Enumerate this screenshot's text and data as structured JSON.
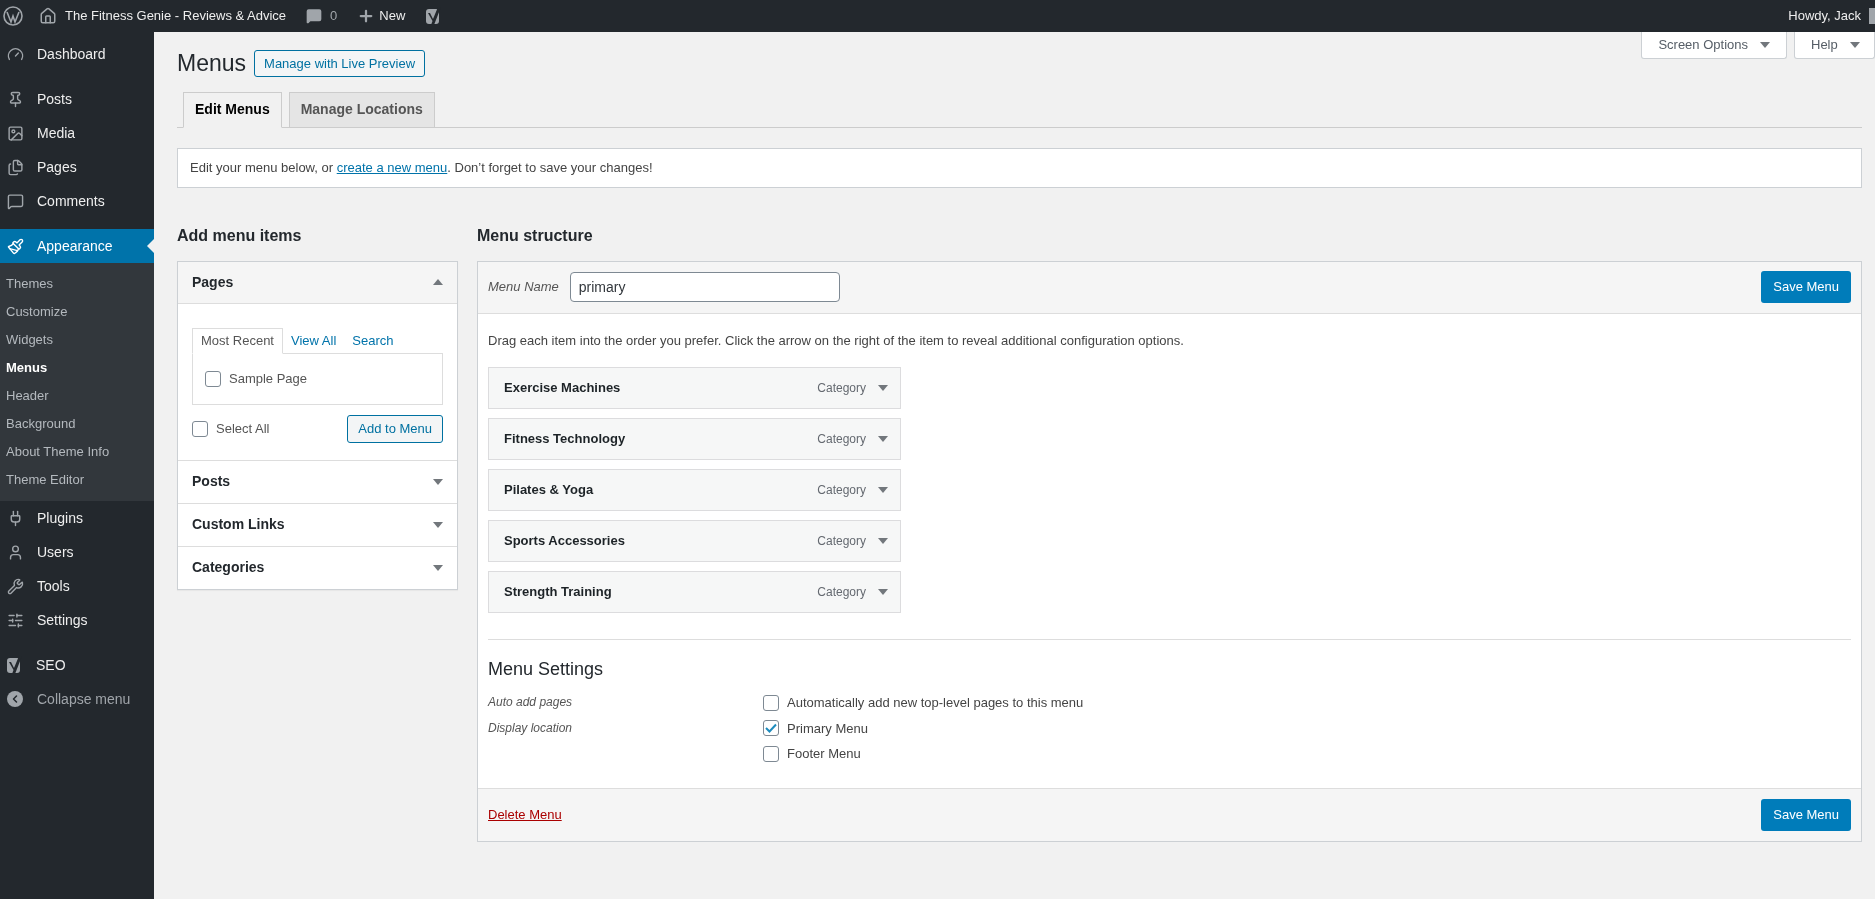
{
  "admin_bar": {
    "site_title": "The Fitness Genie - Reviews & Advice",
    "comments_count": "0",
    "new_label": "New",
    "greeting": "Howdy, Jack"
  },
  "sidebar": {
    "items": [
      {
        "label": "Dashboard",
        "selected": false,
        "gap_after": true
      },
      {
        "label": "Posts",
        "selected": false
      },
      {
        "label": "Media",
        "selected": false
      },
      {
        "label": "Pages",
        "selected": false
      },
      {
        "label": "Comments",
        "selected": false,
        "gap_after": true
      },
      {
        "label": "Appearance",
        "selected": true,
        "children": [
          {
            "label": "Themes",
            "selected": false
          },
          {
            "label": "Customize",
            "selected": false
          },
          {
            "label": "Widgets",
            "selected": false
          },
          {
            "label": "Menus",
            "selected": true
          },
          {
            "label": "Header",
            "selected": false
          },
          {
            "label": "Background",
            "selected": false
          },
          {
            "label": "About Theme Info",
            "selected": false
          },
          {
            "label": "Theme Editor",
            "selected": false
          }
        ]
      },
      {
        "label": "Plugins",
        "selected": false
      },
      {
        "label": "Users",
        "selected": false
      },
      {
        "label": "Tools",
        "selected": false
      },
      {
        "label": "Settings",
        "selected": false,
        "gap_after": true
      },
      {
        "label": "SEO",
        "selected": false
      },
      {
        "label": "Collapse menu",
        "selected": false,
        "kind": "collapse"
      }
    ]
  },
  "screen_meta": [
    "Screen Options",
    "Help"
  ],
  "page": {
    "title": "Menus",
    "action": "Manage with Live Preview",
    "tabs": [
      {
        "label": "Edit Menus",
        "selected": true
      },
      {
        "label": "Manage Locations",
        "selected": false
      }
    ],
    "notice": {
      "before": "Edit your menu below, or ",
      "link": "create a new menu",
      "after": ". Don’t forget to save your changes!"
    }
  },
  "add_menu_items": {
    "heading": "Add menu items",
    "sections": [
      {
        "title": "Pages",
        "expanded": true
      },
      {
        "title": "Posts",
        "expanded": false
      },
      {
        "title": "Custom Links",
        "expanded": false
      },
      {
        "title": "Categories",
        "expanded": false
      }
    ],
    "pages_tabs": [
      {
        "label": "Most Recent",
        "selected": true
      },
      {
        "label": "View All",
        "selected": false
      },
      {
        "label": "Search",
        "selected": false
      }
    ],
    "pages": [
      {
        "label": "Sample Page",
        "checked": false
      }
    ],
    "select_all": {
      "label": "Select All",
      "checked": false
    },
    "add_button": "Add to Menu"
  },
  "menu_structure": {
    "heading": "Menu structure",
    "menu_name_label": "Menu Name",
    "menu_name_value": "primary",
    "save_button": "Save Menu",
    "instructions": "Drag each item into the order you prefer. Click the arrow on the right of the item to reveal additional configuration options.",
    "items": [
      {
        "title": "Exercise Machines",
        "type": "Category"
      },
      {
        "title": "Fitness Technology",
        "type": "Category"
      },
      {
        "title": "Pilates & Yoga",
        "type": "Category"
      },
      {
        "title": "Sports Accessories",
        "type": "Category"
      },
      {
        "title": "Strength Training",
        "type": "Category"
      }
    ],
    "settings": {
      "heading": "Menu Settings",
      "rows": [
        {
          "label": "Auto add pages",
          "options": [
            {
              "label": "Automatically add new top-level pages to this menu",
              "checked": false
            }
          ]
        },
        {
          "label": "Display location",
          "options": [
            {
              "label": "Primary Menu",
              "checked": true
            },
            {
              "label": "Footer Menu",
              "checked": false
            }
          ]
        }
      ]
    },
    "delete_link": "Delete Menu",
    "footer_save_button": "Save Menu"
  }
}
